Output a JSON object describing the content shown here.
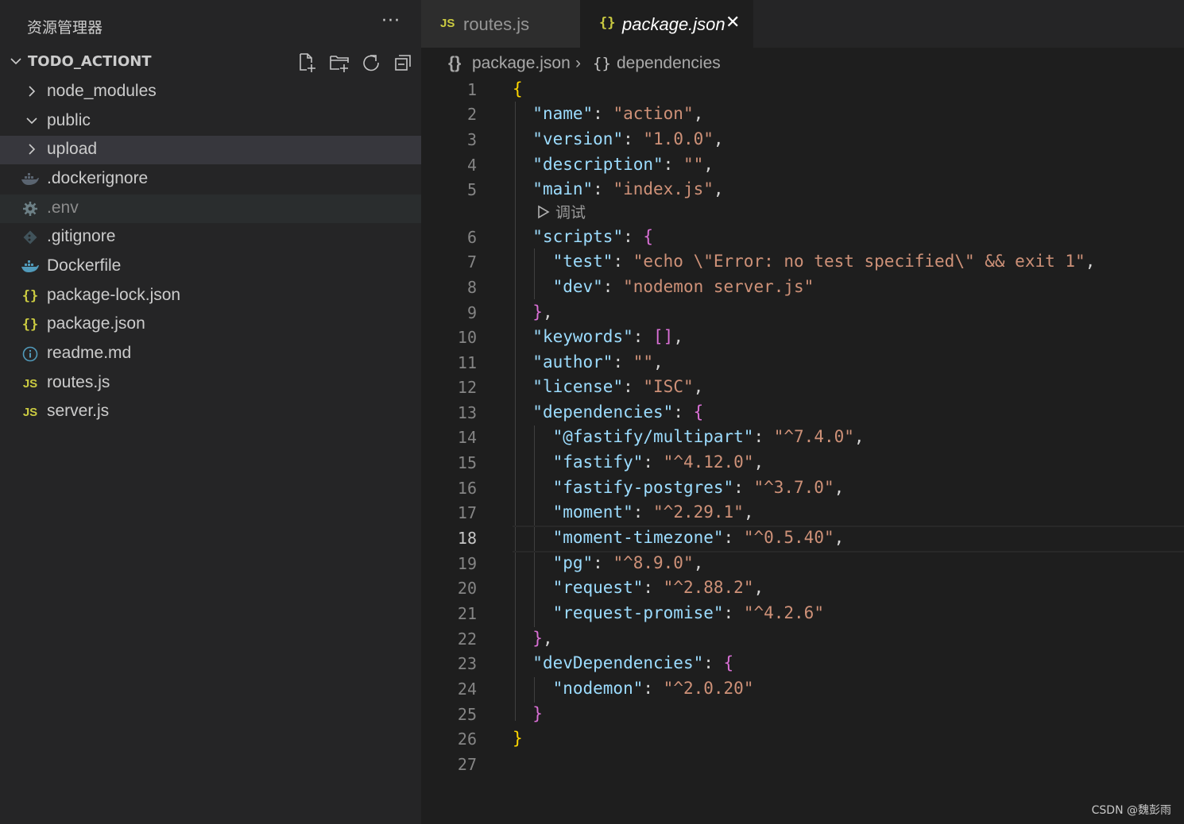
{
  "sidebar": {
    "title": "资源管理器",
    "more_label": "···",
    "section_name": "TODO_ACTIONT",
    "items": [
      {
        "label": "node_modules",
        "type": "folder",
        "expanded": false
      },
      {
        "label": "public",
        "type": "folder",
        "expanded": true
      },
      {
        "label": "upload",
        "type": "folder",
        "expanded": false,
        "selected": true
      },
      {
        "label": ".dockerignore",
        "icon": "docker-icon"
      },
      {
        "label": ".env",
        "icon": "gear-icon"
      },
      {
        "label": ".gitignore",
        "icon": "git-icon"
      },
      {
        "label": "Dockerfile",
        "icon": "docker-icon"
      },
      {
        "label": "package-lock.json",
        "icon": "json-icon"
      },
      {
        "label": "package.json",
        "icon": "json-icon"
      },
      {
        "label": "readme.md",
        "icon": "info-icon"
      },
      {
        "label": "routes.js",
        "icon": "js-icon"
      },
      {
        "label": "server.js",
        "icon": "js-icon"
      }
    ]
  },
  "tabs": [
    {
      "label": "routes.js",
      "icon_text": "JS",
      "active": false
    },
    {
      "label": "package.json",
      "icon_text": "{}",
      "active": true,
      "close": "✕"
    }
  ],
  "breadcrumb": {
    "file_icon": "{}",
    "file": "package.json",
    "sep": "›",
    "symbol_icon": "{}",
    "symbol": "dependencies"
  },
  "editor": {
    "codelens": "调试",
    "current_line": 18,
    "line_numbers": [
      "1",
      "2",
      "3",
      "4",
      "5",
      "6",
      "7",
      "8",
      "9",
      "10",
      "11",
      "12",
      "13",
      "14",
      "15",
      "16",
      "17",
      "18",
      "19",
      "20",
      "21",
      "22",
      "23",
      "24",
      "25",
      "26",
      "27"
    ],
    "lines": [
      [
        [
          "b1",
          "{"
        ]
      ],
      [
        [
          "p",
          "  "
        ],
        [
          "k",
          "\"name\""
        ],
        [
          "p",
          ": "
        ],
        [
          "s",
          "\"action\""
        ],
        [
          "p",
          ","
        ]
      ],
      [
        [
          "p",
          "  "
        ],
        [
          "k",
          "\"version\""
        ],
        [
          "p",
          ": "
        ],
        [
          "s",
          "\"1.0.0\""
        ],
        [
          "p",
          ","
        ]
      ],
      [
        [
          "p",
          "  "
        ],
        [
          "k",
          "\"description\""
        ],
        [
          "p",
          ": "
        ],
        [
          "s",
          "\"\""
        ],
        [
          "p",
          ","
        ]
      ],
      [
        [
          "p",
          "  "
        ],
        [
          "k",
          "\"main\""
        ],
        [
          "p",
          ": "
        ],
        [
          "s",
          "\"index.js\""
        ],
        [
          "p",
          ","
        ]
      ],
      [
        [
          "p",
          "  "
        ],
        [
          "k",
          "\"scripts\""
        ],
        [
          "p",
          ": "
        ],
        [
          "b2",
          "{"
        ]
      ],
      [
        [
          "p",
          "    "
        ],
        [
          "k",
          "\"test\""
        ],
        [
          "p",
          ": "
        ],
        [
          "s",
          "\"echo \\\"Error: no test specified\\\" && exit 1\""
        ],
        [
          "p",
          ","
        ]
      ],
      [
        [
          "p",
          "    "
        ],
        [
          "k",
          "\"dev\""
        ],
        [
          "p",
          ": "
        ],
        [
          "s",
          "\"nodemon server.js\""
        ]
      ],
      [
        [
          "p",
          "  "
        ],
        [
          "b2",
          "}"
        ],
        [
          "p",
          ","
        ]
      ],
      [
        [
          "p",
          "  "
        ],
        [
          "k",
          "\"keywords\""
        ],
        [
          "p",
          ": "
        ],
        [
          "b2",
          "[]"
        ],
        [
          "p",
          ","
        ]
      ],
      [
        [
          "p",
          "  "
        ],
        [
          "k",
          "\"author\""
        ],
        [
          "p",
          ": "
        ],
        [
          "s",
          "\"\""
        ],
        [
          "p",
          ","
        ]
      ],
      [
        [
          "p",
          "  "
        ],
        [
          "k",
          "\"license\""
        ],
        [
          "p",
          ": "
        ],
        [
          "s",
          "\"ISC\""
        ],
        [
          "p",
          ","
        ]
      ],
      [
        [
          "p",
          "  "
        ],
        [
          "k",
          "\"dependencies\""
        ],
        [
          "p",
          ": "
        ],
        [
          "b2",
          "{"
        ]
      ],
      [
        [
          "p",
          "    "
        ],
        [
          "k",
          "\"@fastify/multipart\""
        ],
        [
          "p",
          ": "
        ],
        [
          "s",
          "\"^7.4.0\""
        ],
        [
          "p",
          ","
        ]
      ],
      [
        [
          "p",
          "    "
        ],
        [
          "k",
          "\"fastify\""
        ],
        [
          "p",
          ": "
        ],
        [
          "s",
          "\"^4.12.0\""
        ],
        [
          "p",
          ","
        ]
      ],
      [
        [
          "p",
          "    "
        ],
        [
          "k",
          "\"fastify-postgres\""
        ],
        [
          "p",
          ": "
        ],
        [
          "s",
          "\"^3.7.0\""
        ],
        [
          "p",
          ","
        ]
      ],
      [
        [
          "p",
          "    "
        ],
        [
          "k",
          "\"moment\""
        ],
        [
          "p",
          ": "
        ],
        [
          "s",
          "\"^2.29.1\""
        ],
        [
          "p",
          ","
        ]
      ],
      [
        [
          "p",
          "    "
        ],
        [
          "k",
          "\"moment-timezone\""
        ],
        [
          "p",
          ": "
        ],
        [
          "s",
          "\"^0.5.40\""
        ],
        [
          "p",
          ","
        ]
      ],
      [
        [
          "p",
          "    "
        ],
        [
          "k",
          "\"pg\""
        ],
        [
          "p",
          ": "
        ],
        [
          "s",
          "\"^8.9.0\""
        ],
        [
          "p",
          ","
        ]
      ],
      [
        [
          "p",
          "    "
        ],
        [
          "k",
          "\"request\""
        ],
        [
          "p",
          ": "
        ],
        [
          "s",
          "\"^2.88.2\""
        ],
        [
          "p",
          ","
        ]
      ],
      [
        [
          "p",
          "    "
        ],
        [
          "k",
          "\"request-promise\""
        ],
        [
          "p",
          ": "
        ],
        [
          "s",
          "\"^4.2.6\""
        ]
      ],
      [
        [
          "p",
          "  "
        ],
        [
          "b2",
          "}"
        ],
        [
          "p",
          ","
        ]
      ],
      [
        [
          "p",
          "  "
        ],
        [
          "k",
          "\"devDependencies\""
        ],
        [
          "p",
          ": "
        ],
        [
          "b2",
          "{"
        ]
      ],
      [
        [
          "p",
          "    "
        ],
        [
          "k",
          "\"nodemon\""
        ],
        [
          "p",
          ": "
        ],
        [
          "s",
          "\"^2.0.20\""
        ]
      ],
      [
        [
          "p",
          "  "
        ],
        [
          "b2",
          "}"
        ]
      ],
      [
        [
          "b1",
          "}"
        ]
      ],
      []
    ]
  },
  "watermark": "CSDN @魏彭雨",
  "colors": {
    "sidebar_bg": "#252526",
    "editor_bg": "#1e1e1e",
    "key": "#9cdcfe",
    "string": "#ce9178",
    "bracket_gold": "#ffd700",
    "bracket_pink": "#da70d6",
    "icon_yellow": "#cbcb41"
  }
}
